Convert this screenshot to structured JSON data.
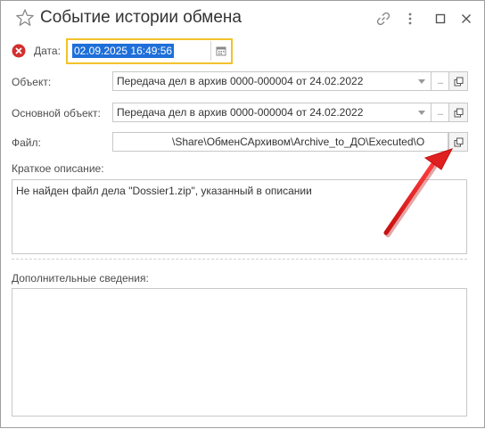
{
  "window": {
    "title": "Событие истории обмена",
    "icons": [
      "star-icon",
      "link-icon",
      "more-icon",
      "maximize-icon",
      "close-icon"
    ]
  },
  "date": {
    "label": "Дата:",
    "value": "02.09.2025 16:49:56",
    "status_icon": "error-icon",
    "calendar_icon": "calendar-icon"
  },
  "object": {
    "label": "Объект:",
    "value": "Передача дел в архив 0000-000004 от 24.02.2022",
    "dots": "..."
  },
  "main_object": {
    "label": "Основной объект:",
    "value": "Передача дел в архив 0000-000004 от 24.02.2022",
    "dots": "..."
  },
  "file": {
    "label": "Файл:",
    "value": "\\Share\\ОбменСАрхивом\\Archive_to_ДО\\Executed\\О"
  },
  "short_description": {
    "label": "Краткое описание:",
    "value": "Не найден файл дела \"Dossier1.zip\", указанный в описании"
  },
  "additional_info": {
    "label": "Дополнительные сведения:",
    "value": ""
  },
  "colors": {
    "accent_border": "#f2c22b",
    "selection": "#1e6fd9",
    "arrow": "#e02020",
    "error": "#d32f2f"
  }
}
